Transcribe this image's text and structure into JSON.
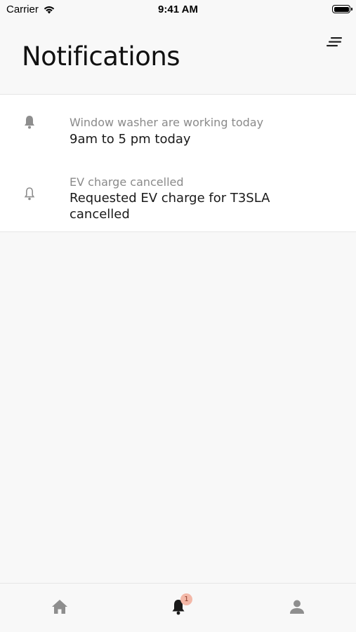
{
  "status_bar": {
    "carrier": "Carrier",
    "time": "9:41 AM"
  },
  "header": {
    "title": "Notifications",
    "menu_icon": "sort-lines-icon"
  },
  "notifications": [
    {
      "title": "Window washer are working today",
      "body": "9am to 5 pm today",
      "icon": "bell-filled-icon"
    },
    {
      "title": "EV charge cancelled",
      "body": "Requested EV charge for T3SLA cancelled",
      "icon": "bell-outline-icon"
    }
  ],
  "tab_bar": {
    "tabs": [
      {
        "name": "home",
        "icon": "home-icon",
        "active": false
      },
      {
        "name": "notifications",
        "icon": "bell-filled-icon",
        "active": true,
        "badge": "1"
      },
      {
        "name": "profile",
        "icon": "person-icon",
        "active": false
      }
    ]
  },
  "colors": {
    "background": "#f8f8f8",
    "card": "#ffffff",
    "badge": "#f3b8a8",
    "inactive_icon": "#8e8e8e",
    "active_icon": "#1a1a1a"
  }
}
